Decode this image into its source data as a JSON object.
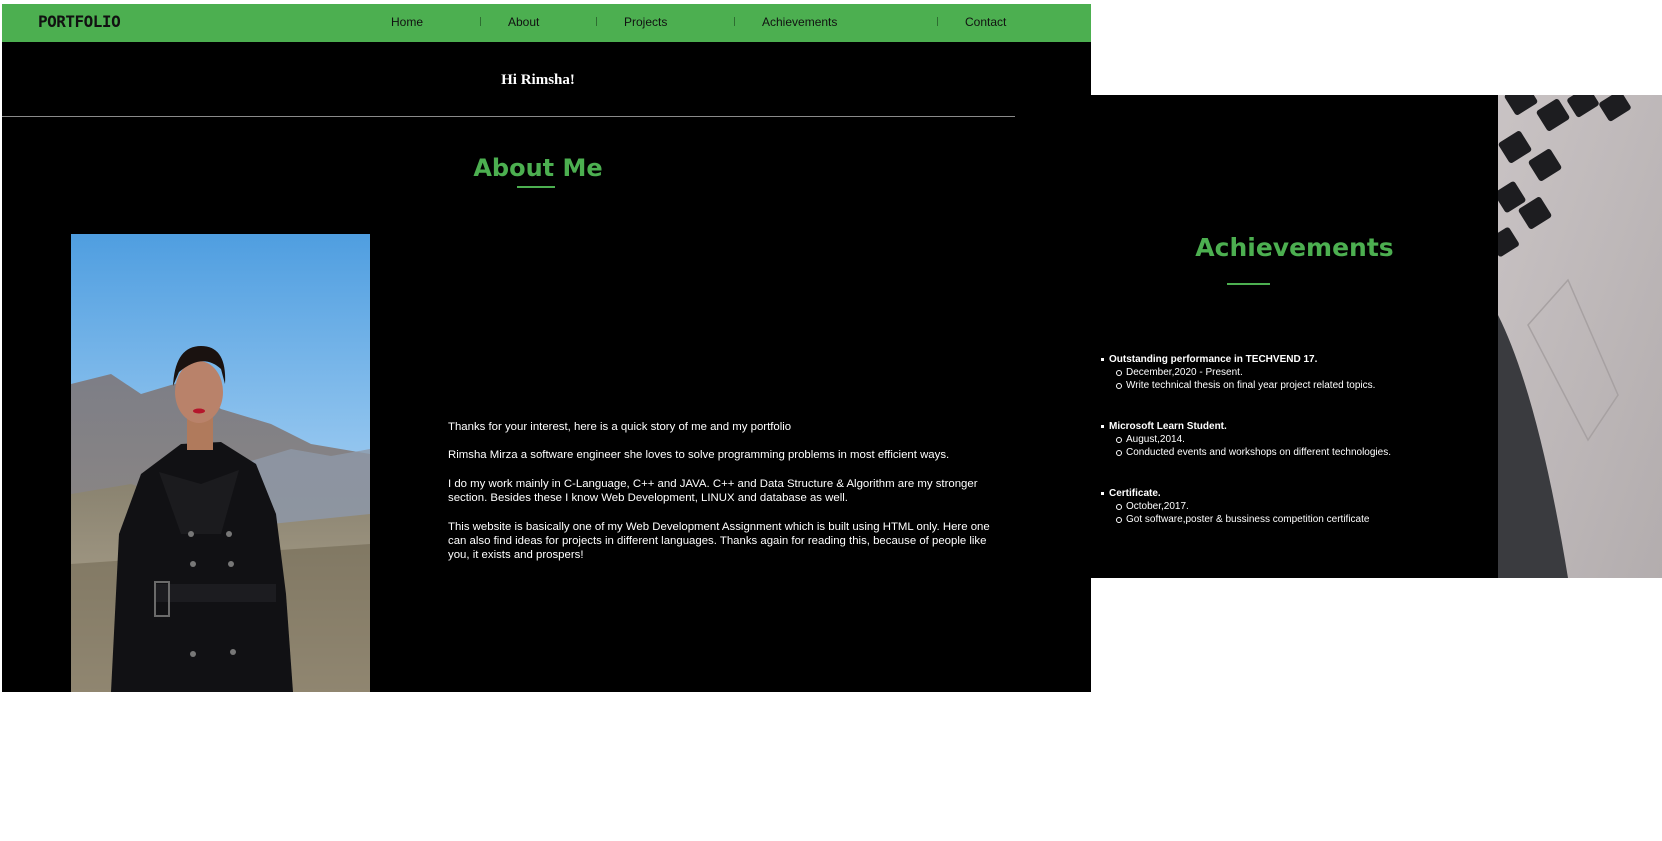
{
  "navbar": {
    "brand": "PORTFOLIO",
    "links": [
      "Home",
      "About",
      "Projects",
      "Achievements",
      "Contact"
    ]
  },
  "greeting": "Hi Rimsha!",
  "about": {
    "title": "About Me",
    "paragraphs": [
      "Thanks for your interest, here is a quick story of me and my portfolio",
      "Rimsha Mirza a software engineer she loves to solve programming problems in most efficient ways.",
      "I do my work mainly in C-Language, C++ and JAVA. C++ and Data Structure & Algorithm are my stronger section. Besides these I know Web Development, LINUX and database as well.",
      "This website is basically one of my Web Development Assignment which is built using HTML only. Here one can also find ideas for projects in different languages. Thanks again for reading this, because of people like you, it exists and prospers!"
    ]
  },
  "achievements": {
    "title": "Achievements",
    "items": [
      {
        "title": "Outstanding performance in TECHVEND 17.",
        "details": [
          "December,2020 - Present.",
          "Write technical thesis on final year project related topics."
        ]
      },
      {
        "title": "Microsoft Learn Student.",
        "details": [
          "August,2014.",
          "Conducted events and workshops on different technologies."
        ]
      },
      {
        "title": "Certificate.",
        "details": [
          "October,2017.",
          "Got software,poster & bussiness competition certificate"
        ]
      }
    ]
  },
  "colors": {
    "accent": "#4caf50",
    "background": "#000000",
    "text": "#ffffff"
  }
}
